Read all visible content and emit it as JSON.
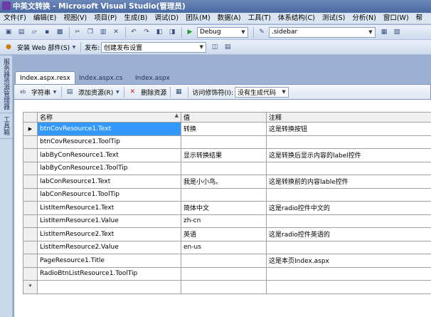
{
  "window": {
    "title": "中英文转换 - Microsoft Visual Studio(管理员)"
  },
  "menu": [
    "文件(F)",
    "编辑(E)",
    "视图(V)",
    "项目(P)",
    "生成(B)",
    "调试(D)",
    "团队(M)",
    "数据(A)",
    "工具(T)",
    "体系结构(C)",
    "测试(S)",
    "分析(N)",
    "窗口(W)",
    "帮"
  ],
  "toolbar": {
    "config_value": "Debug",
    "find_value": ".sidebar",
    "install_web_parts_label": "安装 Web 部件(S)",
    "publish_label": "发布:",
    "publish_value": "创建发布设置"
  },
  "sidebar": {
    "tabs": [
      "服务器资源管理器",
      "工具箱"
    ]
  },
  "tabs": [
    "Index.aspx.resx",
    "Index.aspx.cs",
    "Index.aspx"
  ],
  "resource_toolbar": {
    "strings_label": "字符串",
    "add_resource_label": "添加资源(R)",
    "remove_resource_label": "删除资源",
    "access_modifier_label": "访问修饰符(I):",
    "access_modifier_value": "没有生成代码"
  },
  "grid": {
    "headers": {
      "name": "名称",
      "value": "值",
      "comment": "注释"
    },
    "rows": [
      {
        "name": "btnCovResource1.Text",
        "value": "转换",
        "comment": "这是转换按钮"
      },
      {
        "name": "btnCovResource1.ToolTip",
        "value": "",
        "comment": ""
      },
      {
        "name": "labByConResource1.Text",
        "value": "显示转换结果",
        "comment": "这是转换后显示内容的label控件"
      },
      {
        "name": "labByConResource1.ToolTip",
        "value": "",
        "comment": ""
      },
      {
        "name": "labConResource1.Text",
        "value": "我是小小鸟。",
        "comment": "这是转换前的内容lable控件"
      },
      {
        "name": "labConResource1.ToolTip",
        "value": "",
        "comment": ""
      },
      {
        "name": "ListItemResource1.Text",
        "value": "简体中文",
        "comment": "这是radio控件中文的"
      },
      {
        "name": "ListItemResource1.Value",
        "value": "zh-cn",
        "comment": ""
      },
      {
        "name": "ListItemResource2.Text",
        "value": "英语",
        "comment": "这是radio控件英语的"
      },
      {
        "name": "ListItemResource2.Value",
        "value": "en-us",
        "comment": ""
      },
      {
        "name": "PageResource1.Title",
        "value": "",
        "comment": "这是本页Index.aspx"
      },
      {
        "name": "RadioBtnListResource1.ToolTip",
        "value": "",
        "comment": ""
      }
    ],
    "new_row_marker": "*",
    "current_row_marker": "▶"
  },
  "colors": {
    "selection": "#3399ff",
    "titlebar": "#4a6aa3"
  }
}
